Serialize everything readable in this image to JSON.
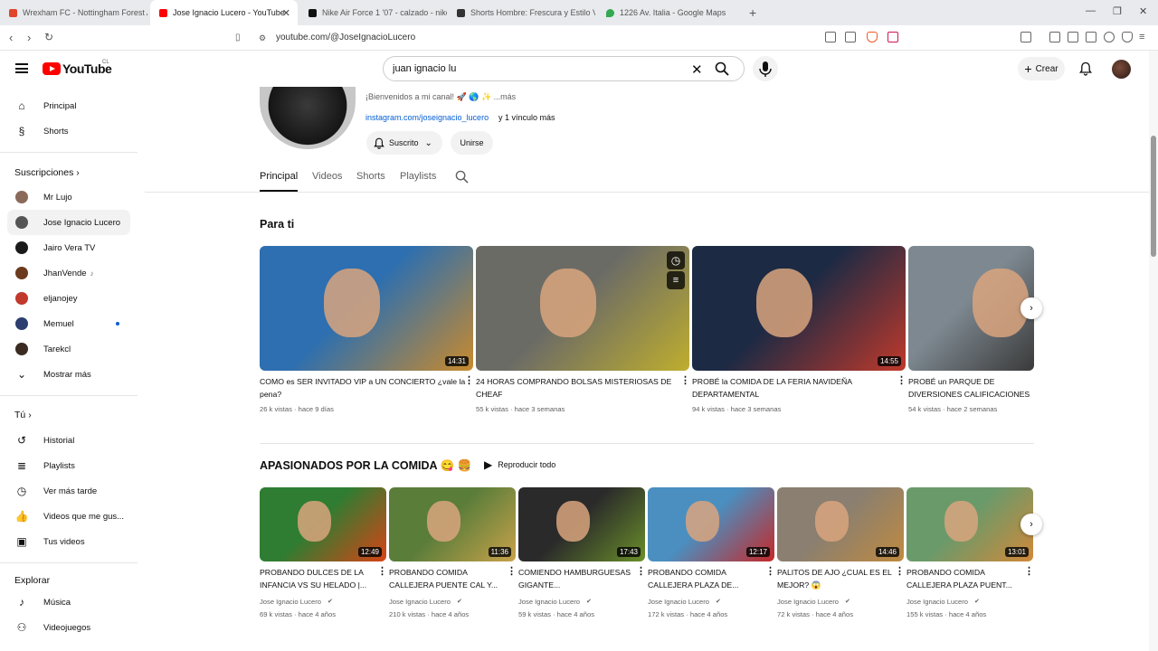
{
  "browser": {
    "tabs": [
      {
        "title": "Wrexham FC - Nottingham Forest Ar",
        "color": "#e1462b"
      },
      {
        "title": "Jose Ignacio Lucero - YouTube",
        "color": "#ff0000",
        "active": true
      },
      {
        "title": "Nike Air Force 1 '07 - calzado - nike",
        "color": "#111111"
      },
      {
        "title": "Shorts Hombre: Frescura y Estilo Ver",
        "color": "#333333"
      },
      {
        "title": "1226 Av. Italia - Google Maps",
        "color": "#34a853"
      }
    ],
    "url": "youtube.com/@JoseIgnacioLucero"
  },
  "header": {
    "logo_text": "YouTube",
    "country": "CL",
    "search_value": "juan ignacio lu",
    "create_label": "Crear"
  },
  "sidebar": {
    "main": [
      {
        "label": "Principal",
        "icon": "home-icon"
      },
      {
        "label": "Shorts",
        "icon": "shorts-icon"
      }
    ],
    "subs_title": "Suscripciones",
    "subs": [
      {
        "label": "Mr Lujo",
        "color": "#8a6a5a"
      },
      {
        "label": "Jose Ignacio Lucero",
        "color": "#555555"
      },
      {
        "label": "Jairo Vera TV",
        "color": "#1a1a1a"
      },
      {
        "label": "JhanVende",
        "color": "#6b3a1f"
      },
      {
        "label": "eljanojey",
        "color": "#c0392b"
      },
      {
        "label": "Memuel",
        "color": "#2c3e70"
      },
      {
        "label": "Tarekcl",
        "color": "#3a2a20"
      }
    ],
    "show_more": "Mostrar más",
    "you_title": "Tú",
    "you": [
      {
        "label": "Historial",
        "icon": "history-icon"
      },
      {
        "label": "Playlists",
        "icon": "playlists-icon"
      },
      {
        "label": "Ver más tarde",
        "icon": "watch-later-icon"
      },
      {
        "label": "Videos que me gus...",
        "icon": "like-icon"
      },
      {
        "label": "Tus videos",
        "icon": "your-videos-icon"
      }
    ],
    "explore_title": "Explorar",
    "explore": [
      {
        "label": "Música",
        "icon": "music-icon"
      },
      {
        "label": "Videojuegos",
        "icon": "gaming-icon"
      }
    ]
  },
  "channel": {
    "description": "¡Bienvenidos a mi canal! 🚀 🌎 ✨ ...más",
    "link": "instagram.com/joseignacio_lucero",
    "link_more": "y 1 vínculo más",
    "subscribed_label": "Suscrito",
    "join_label": "Unirse",
    "tabs": [
      "Principal",
      "Videos",
      "Shorts",
      "Playlists"
    ]
  },
  "para_ti": {
    "title": "Para ti",
    "videos": [
      {
        "title": "COMO es SER INVITADO VIP a UN CONCIERTO ¿vale la pena?",
        "meta": "26 k vistas · hace 9 días",
        "duration": "14:31",
        "c1": "#2d6fb0",
        "c2": "#c98a2c"
      },
      {
        "title": "24 HORAS COMPRANDO BOLSAS MISTERIOSAS DE CHEAF",
        "meta": "55 k vistas · hace 3 semanas",
        "duration": "",
        "c1": "#6b6b66",
        "c2": "#bfae2e"
      },
      {
        "title": "PROBÉ la COMIDA DE LA FERIA NAVIDEÑA DEPARTAMENTAL",
        "meta": "94 k vistas · hace 3 semanas",
        "duration": "14:55",
        "c1": "#1c2a44",
        "c2": "#c0392b"
      },
      {
        "title": "PROBÉ un PARQUE DE DIVERSIONES CALIFICACIONES en MAIPÚ",
        "meta": "54 k vistas · hace 2 semanas",
        "duration": "",
        "c1": "#7d8890",
        "c2": "#3a3a3a"
      }
    ]
  },
  "food": {
    "title": "APASIONADOS POR LA COMIDA 😋 🍔",
    "play_all": "Reproducir todo",
    "channel_name": "Jose Ignacio Lucero",
    "videos": [
      {
        "title": "PROBANDO DULCES DE LA INFANCIA VS SU HELADO |...",
        "meta": "69 k vistas · hace 4 años",
        "duration": "12:49",
        "c1": "#2e7d32",
        "c2": "#d84315"
      },
      {
        "title": "PROBANDO COMIDA CALLEJERA PUENTE CAL Y...",
        "meta": "210 k vistas · hace 4 años",
        "duration": "11:36",
        "c1": "#5a7d3a",
        "c2": "#c9a24a"
      },
      {
        "title": "COMIENDO HAMBURGUESAS GIGANTE...",
        "meta": "59 k vistas · hace 4 años",
        "duration": "17:43",
        "c1": "#2a2a2a",
        "c2": "#6a8f2a"
      },
      {
        "title": "PROBANDO COMIDA CALLEJERA PLAZA DE...",
        "meta": "172 k vistas · hace 4 años",
        "duration": "12:17",
        "c1": "#4a8fc0",
        "c2": "#c62828"
      },
      {
        "title": "PALITOS DE AJO ¿CUAL ES EL MEJOR? 😱",
        "meta": "72 k vistas · hace 4 años",
        "duration": "14:46",
        "c1": "#8a7f70",
        "c2": "#c08a40"
      },
      {
        "title": "PROBANDO COMIDA CALLEJERA PLAZA PUENT...",
        "meta": "155 k vistas · hace 4 años",
        "duration": "13:01",
        "c1": "#6a9a6a",
        "c2": "#d2883a"
      }
    ]
  }
}
